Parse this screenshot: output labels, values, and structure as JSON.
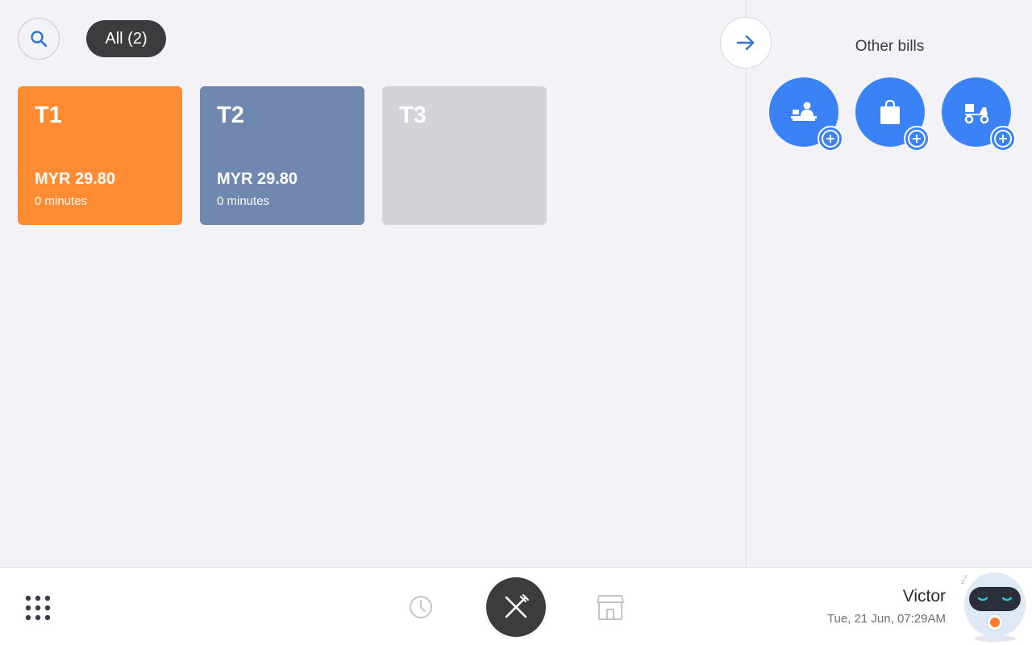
{
  "filter": {
    "label": "All (2)"
  },
  "tables": [
    {
      "name": "T1",
      "amount": "MYR 29.80",
      "duration": "0 minutes",
      "status": "occupied",
      "color": "#ff8c33"
    },
    {
      "name": "T2",
      "amount": "MYR 29.80",
      "duration": "0 minutes",
      "status": "occupied",
      "color": "#7088b0"
    },
    {
      "name": "T3",
      "amount": "",
      "duration": "",
      "status": "empty",
      "color": "#d3d3d9"
    }
  ],
  "other_bills": {
    "title": "Other bills",
    "buttons": [
      {
        "icon": "counter-icon"
      },
      {
        "icon": "shopping-bag-icon"
      },
      {
        "icon": "delivery-scooter-icon"
      }
    ],
    "color": "#3b82f6"
  },
  "bottom_nav": {
    "items": [
      {
        "icon": "grid-icon"
      },
      {
        "icon": "history-clock-icon"
      },
      {
        "icon": "dine-in-fork-knife-icon"
      },
      {
        "icon": "store-icon"
      }
    ]
  },
  "user": {
    "name": "Victor",
    "datetime": "Tue, 21 Jun, 07:29AM"
  },
  "colors": {
    "accent": "#3b82f6",
    "dark": "#3c3c3e",
    "background": "#f2f2f7"
  }
}
